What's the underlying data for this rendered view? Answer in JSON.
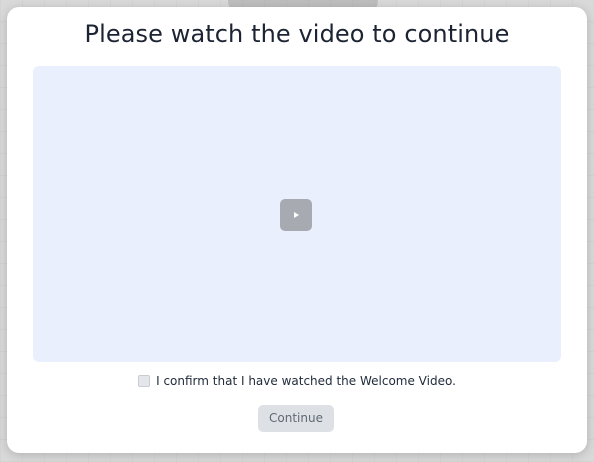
{
  "modal": {
    "title": "Please watch the video to continue"
  },
  "video": {
    "play_icon": "play-icon",
    "background_color": "#eaeffd",
    "play_button_color": "#a7aab0"
  },
  "confirmation": {
    "label": "I confirm that I have watched the Welcome Video.",
    "checked": false
  },
  "actions": {
    "continue_label": "Continue",
    "continue_enabled": false
  }
}
